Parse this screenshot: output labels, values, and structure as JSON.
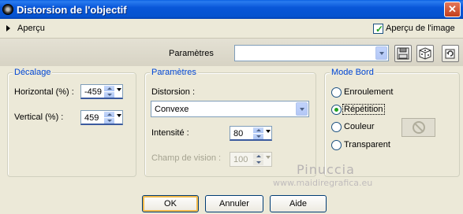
{
  "window": {
    "title": "Distorsion de l'objectif"
  },
  "preview": {
    "label": "Aperçu",
    "image_preview_label": "Aperçu de l'image",
    "image_preview_checked": true
  },
  "params_bar": {
    "label": "Paramètres",
    "preset_value": ""
  },
  "decalage": {
    "title": "Décalage",
    "horizontal_label": "Horizontal (%) :",
    "horizontal_value": "-459",
    "vertical_label": "Vertical (%) :",
    "vertical_value": "459"
  },
  "parametres": {
    "title": "Paramètres",
    "distorsion_label": "Distorsion :",
    "distorsion_value": "Convexe",
    "intensite_label": "Intensité :",
    "intensite_value": "80",
    "champ_label": "Champ de vision :",
    "champ_value": "100"
  },
  "mode_bord": {
    "title": "Mode Bord",
    "options": [
      "Enroulement",
      "Répétition",
      "Couleur",
      "Transparent"
    ],
    "selected": "Répétition"
  },
  "watermark": {
    "name": "Pinuccia",
    "url": "www.maidiregrafica.eu"
  },
  "buttons": {
    "ok": "OK",
    "cancel": "Annuler",
    "help": "Aide"
  },
  "colors": {
    "titlebar": "#0553cf",
    "group_title": "#0046d5",
    "radio_dot": "#21a121"
  }
}
